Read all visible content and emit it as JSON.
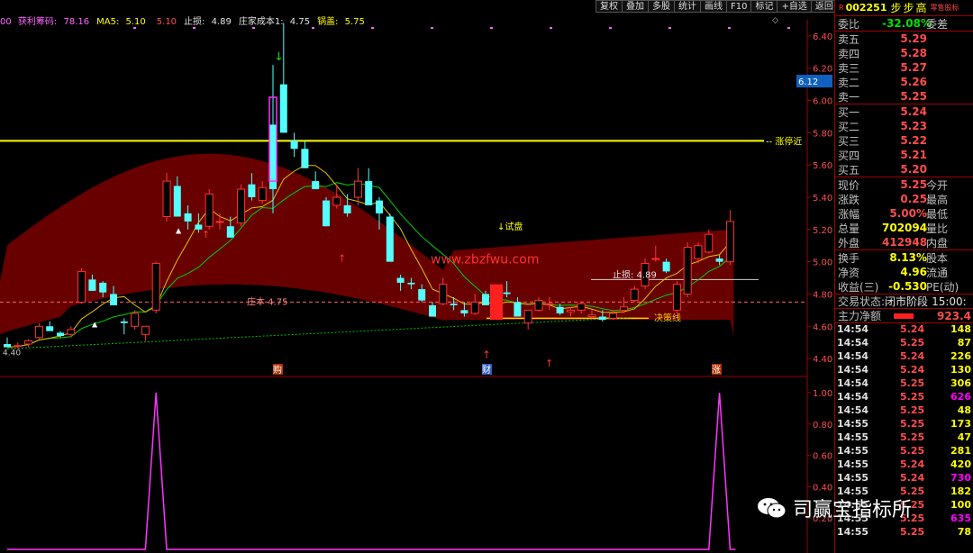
{
  "toolbar": [
    "复权",
    "叠加",
    "多股",
    "统计",
    "画线",
    "F10",
    "标记",
    "+自选",
    "返回"
  ],
  "header": {
    "prefix": "00",
    "items": [
      {
        "label": "获利筹码: ",
        "value": "78.16",
        "color": "#ff66ff"
      },
      {
        "label": "MA5: ",
        "value": "5.10",
        "color": "#ffff00"
      },
      {
        "label": "",
        "value": "5.10",
        "color": "#ff4d4d"
      },
      {
        "label": "止损: ",
        "value": "4.89",
        "color": "#e0e0e0"
      },
      {
        "label": "庄家成本1: ",
        "value": "4.75",
        "color": "#e0e0e0"
      },
      {
        "label": "锅盖: ",
        "value": "5.75",
        "color": "#ffff00"
      }
    ]
  },
  "price_axis": [
    "6.40",
    "6.20",
    "6.00",
    "5.80",
    "5.60",
    "5.40",
    "5.20",
    "5.00",
    "4.80",
    "4.60",
    "4.40"
  ],
  "current_price_tag": "6.12",
  "indicator_axis": [
    "1.00",
    "0.80",
    "0.60",
    "0.40",
    "0.20"
  ],
  "annotations": {
    "limit_up_line": "涨停近",
    "trial_label": "试盘",
    "watermark_url": "www.zbzfwu.com",
    "stop_loss": "止损: 4.89",
    "zhuang_cost": "庄本 4.75",
    "decision_line": "决策线",
    "axis_left_value": "4.40",
    "marker_buy": "购",
    "marker_cai": "财",
    "marker_zhang": "涨"
  },
  "stock": {
    "code": "002251",
    "name": "步步高",
    "tag": "零售股标"
  },
  "quote": {
    "weibi_label": "委比",
    "weibi_value": "-32.08%",
    "weicha_label": "委差",
    "sell": [
      {
        "label": "卖五",
        "price": "5.29"
      },
      {
        "label": "卖四",
        "price": "5.28"
      },
      {
        "label": "卖三",
        "price": "5.27"
      },
      {
        "label": "卖二",
        "price": "5.26"
      },
      {
        "label": "卖一",
        "price": "5.25"
      }
    ],
    "buy": [
      {
        "label": "买一",
        "price": "5.24"
      },
      {
        "label": "买二",
        "price": "5.23"
      },
      {
        "label": "买三",
        "price": "5.22"
      },
      {
        "label": "买四",
        "price": "5.21"
      },
      {
        "label": "买五",
        "price": "5.20"
      }
    ],
    "stats": [
      {
        "l1": "现价",
        "v": "5.25",
        "l2": "今开",
        "cls": "red"
      },
      {
        "l1": "涨跌",
        "v": "0.25",
        "l2": "最高",
        "cls": "red"
      },
      {
        "l1": "涨幅",
        "v": "5.00%",
        "l2": "最低",
        "cls": "red"
      },
      {
        "l1": "总量",
        "v": "702094",
        "l2": "量比",
        "cls": "yel"
      },
      {
        "l1": "外盘",
        "v": "412948",
        "l2": "内盘",
        "cls": "red"
      }
    ],
    "stats2": [
      {
        "l1": "换手",
        "v": "8.13%",
        "l2": "股本",
        "cls": "yel"
      },
      {
        "l1": "净资",
        "v": "4.96",
        "l2": "流通",
        "cls": "yel"
      },
      {
        "l1": "收益(三)",
        "v": "-0.530",
        "l2": "PE(动)",
        "cls": "yel"
      }
    ],
    "trade_status_label": "交易状态:",
    "trade_status_value": "闭市阶段",
    "trade_time": "15:00:",
    "main_net_label": "主力净额",
    "main_net_value": "923.4"
  },
  "trades": [
    {
      "t": "14:54",
      "p": "5.24",
      "v": "148",
      "pc": "red",
      "vc": "yel"
    },
    {
      "t": "14:54",
      "p": "5.25",
      "v": "87",
      "pc": "red",
      "vc": "yel"
    },
    {
      "t": "14:54",
      "p": "5.24",
      "v": "226",
      "pc": "red",
      "vc": "yel"
    },
    {
      "t": "14:54",
      "p": "5.24",
      "v": "130",
      "pc": "red",
      "vc": "yel"
    },
    {
      "t": "14:54",
      "p": "5.25",
      "v": "306",
      "pc": "red",
      "vc": "yel"
    },
    {
      "t": "14:54",
      "p": "5.25",
      "v": "626",
      "pc": "red",
      "vc": "mag"
    },
    {
      "t": "14:54",
      "p": "5.25",
      "v": "48",
      "pc": "red",
      "vc": "yel"
    },
    {
      "t": "14:55",
      "p": "5.25",
      "v": "173",
      "pc": "red",
      "vc": "yel"
    },
    {
      "t": "14:55",
      "p": "5.25",
      "v": "47",
      "pc": "red",
      "vc": "yel"
    },
    {
      "t": "14:55",
      "p": "5.25",
      "v": "281",
      "pc": "red",
      "vc": "yel"
    },
    {
      "t": "14:55",
      "p": "5.24",
      "v": "420",
      "pc": "red",
      "vc": "yel"
    },
    {
      "t": "14:55",
      "p": "5.24",
      "v": "730",
      "pc": "red",
      "vc": "mag"
    },
    {
      "t": "14:55",
      "p": "5.25",
      "v": "182",
      "pc": "red",
      "vc": "yel"
    },
    {
      "t": "14:55",
      "p": "5.25",
      "v": "100",
      "pc": "red",
      "vc": "yel"
    },
    {
      "t": "14:55",
      "p": "5.25",
      "v": "635",
      "pc": "red",
      "vc": "mag"
    },
    {
      "t": "14:55",
      "p": "5.25",
      "v": "78",
      "pc": "red",
      "vc": "yel"
    }
  ],
  "watermark_text": "司赢宝指标所",
  "candles": [
    [
      4.49,
      4.53,
      4.47,
      4.47
    ],
    [
      4.48,
      4.5,
      4.46,
      4.48
    ],
    [
      4.49,
      4.52,
      4.47,
      4.51
    ],
    [
      4.53,
      4.62,
      4.52,
      4.6
    ],
    [
      4.6,
      4.63,
      4.58,
      4.57
    ],
    [
      4.56,
      4.57,
      4.53,
      4.54
    ],
    [
      4.55,
      4.6,
      4.53,
      4.58
    ],
    [
      4.75,
      4.96,
      4.74,
      4.94
    ],
    [
      4.89,
      4.92,
      4.82,
      4.82
    ],
    [
      4.87,
      4.88,
      4.78,
      4.81
    ],
    [
      4.8,
      4.85,
      4.75,
      4.73
    ],
    [
      4.63,
      4.65,
      4.55,
      4.62
    ],
    [
      4.6,
      4.7,
      4.58,
      4.68
    ],
    [
      4.55,
      4.6,
      4.51,
      4.6
    ],
    [
      4.7,
      5.0,
      4.68,
      4.99
    ],
    [
      5.28,
      5.55,
      5.25,
      5.5
    ],
    [
      5.47,
      5.53,
      5.28,
      5.28
    ],
    [
      5.3,
      5.35,
      5.2,
      5.25
    ],
    [
      5.23,
      5.3,
      5.18,
      5.2
    ],
    [
      5.22,
      5.45,
      5.2,
      5.42
    ],
    [
      5.25,
      5.3,
      5.2,
      5.25
    ],
    [
      5.22,
      5.28,
      5.15,
      5.15
    ],
    [
      5.24,
      5.48,
      5.22,
      5.45
    ],
    [
      5.48,
      5.55,
      5.38,
      5.4
    ],
    [
      5.38,
      5.5,
      5.36,
      5.46
    ],
    [
      5.85,
      6.22,
      5.3,
      5.45
    ],
    [
      6.1,
      6.48,
      5.8,
      5.8
    ],
    [
      5.75,
      5.8,
      5.65,
      5.7
    ],
    [
      5.7,
      5.75,
      5.58,
      5.58
    ],
    [
      5.5,
      5.56,
      5.45,
      5.45
    ],
    [
      5.38,
      5.4,
      5.22,
      5.22
    ],
    [
      5.35,
      5.48,
      5.33,
      5.4
    ],
    [
      5.35,
      5.42,
      5.28,
      5.3
    ],
    [
      5.4,
      5.58,
      5.35,
      5.5
    ],
    [
      5.5,
      5.58,
      5.35,
      5.35
    ],
    [
      5.38,
      5.4,
      5.2,
      5.3
    ],
    [
      5.28,
      5.3,
      5.0,
      5.0
    ],
    [
      4.9,
      4.92,
      4.82,
      4.87
    ],
    [
      4.87,
      4.9,
      4.83,
      4.86
    ],
    [
      4.83,
      4.86,
      4.75,
      4.76
    ],
    [
      4.73,
      4.75,
      4.66,
      4.66
    ],
    [
      4.74,
      4.9,
      4.73,
      4.86
    ],
    [
      4.74,
      4.78,
      4.7,
      4.73
    ],
    [
      4.7,
      4.75,
      4.66,
      4.68
    ],
    [
      4.68,
      4.8,
      4.67,
      4.75
    ],
    [
      4.8,
      4.82,
      4.73,
      4.73
    ],
    [
      4.76,
      4.84,
      4.74,
      4.79
    ],
    [
      4.81,
      4.88,
      4.78,
      4.8
    ],
    [
      4.75,
      4.78,
      4.66,
      4.66
    ],
    [
      4.62,
      4.64,
      4.58,
      4.7
    ],
    [
      4.7,
      4.78,
      4.69,
      4.76
    ],
    [
      4.74,
      4.78,
      4.7,
      4.74
    ],
    [
      4.72,
      4.74,
      4.67,
      4.68
    ],
    [
      4.69,
      4.72,
      4.66,
      4.7
    ],
    [
      4.7,
      4.75,
      4.68,
      4.74
    ],
    [
      4.66,
      4.7,
      4.65,
      4.67
    ],
    [
      4.66,
      4.7,
      4.63,
      4.64
    ],
    [
      4.65,
      4.7,
      4.64,
      4.68
    ],
    [
      4.7,
      4.78,
      4.68,
      4.72
    ],
    [
      4.76,
      4.85,
      4.75,
      4.83
    ],
    [
      4.85,
      5.02,
      4.83,
      4.99
    ],
    [
      5.02,
      5.1,
      5.0,
      5.02
    ],
    [
      5.0,
      5.02,
      4.93,
      4.94
    ],
    [
      4.7,
      4.88,
      4.68,
      4.86
    ],
    [
      4.8,
      5.12,
      4.78,
      5.09
    ],
    [
      5.02,
      5.12,
      4.99,
      5.1
    ],
    [
      5.06,
      5.2,
      5.05,
      5.17
    ],
    [
      5.02,
      5.04,
      4.98,
      5.0
    ],
    [
      5.0,
      5.32,
      4.98,
      5.25
    ]
  ],
  "indicator_peaks": [
    14,
    67
  ]
}
